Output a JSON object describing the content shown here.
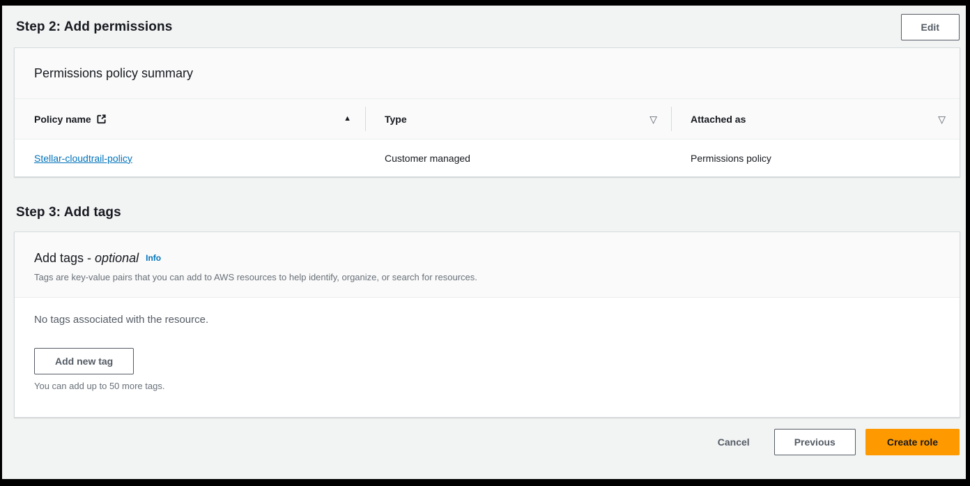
{
  "colors": {
    "page_background": "#f2f3f3",
    "panel_background": "#ffffff",
    "panel_header_background": "#fafafa",
    "link_blue": "#0073bb",
    "primary_orange": "#ff9900",
    "secondary_gray": "#545b64"
  },
  "icons": {
    "sort_ascending": "▲",
    "filter": "▽",
    "external_link": "external-link-icon"
  },
  "step2": {
    "title": "Step 2: Add permissions",
    "edit_label": "Edit"
  },
  "permissions_panel": {
    "title": "Permissions policy summary",
    "table": {
      "columns": [
        {
          "label": "Policy name"
        },
        {
          "label": "Type"
        },
        {
          "label": "Attached as"
        }
      ],
      "rows": [
        {
          "policy_name": "Stellar-cloudtrail-policy",
          "type": "Customer managed",
          "attached_as": "Permissions policy"
        }
      ]
    }
  },
  "step3": {
    "title": "Step 3: Add tags"
  },
  "tags_panel": {
    "title_prefix": "Add tags - ",
    "title_optional": "optional",
    "info_label": "Info",
    "description": "Tags are key-value pairs that you can add to AWS resources to help identify, organize, or search for resources.",
    "empty_message": "No tags associated with the resource.",
    "add_button_label": "Add new tag",
    "limit_note": "You can add up to 50 more tags."
  },
  "footer": {
    "cancel_label": "Cancel",
    "previous_label": "Previous",
    "create_label": "Create role"
  }
}
